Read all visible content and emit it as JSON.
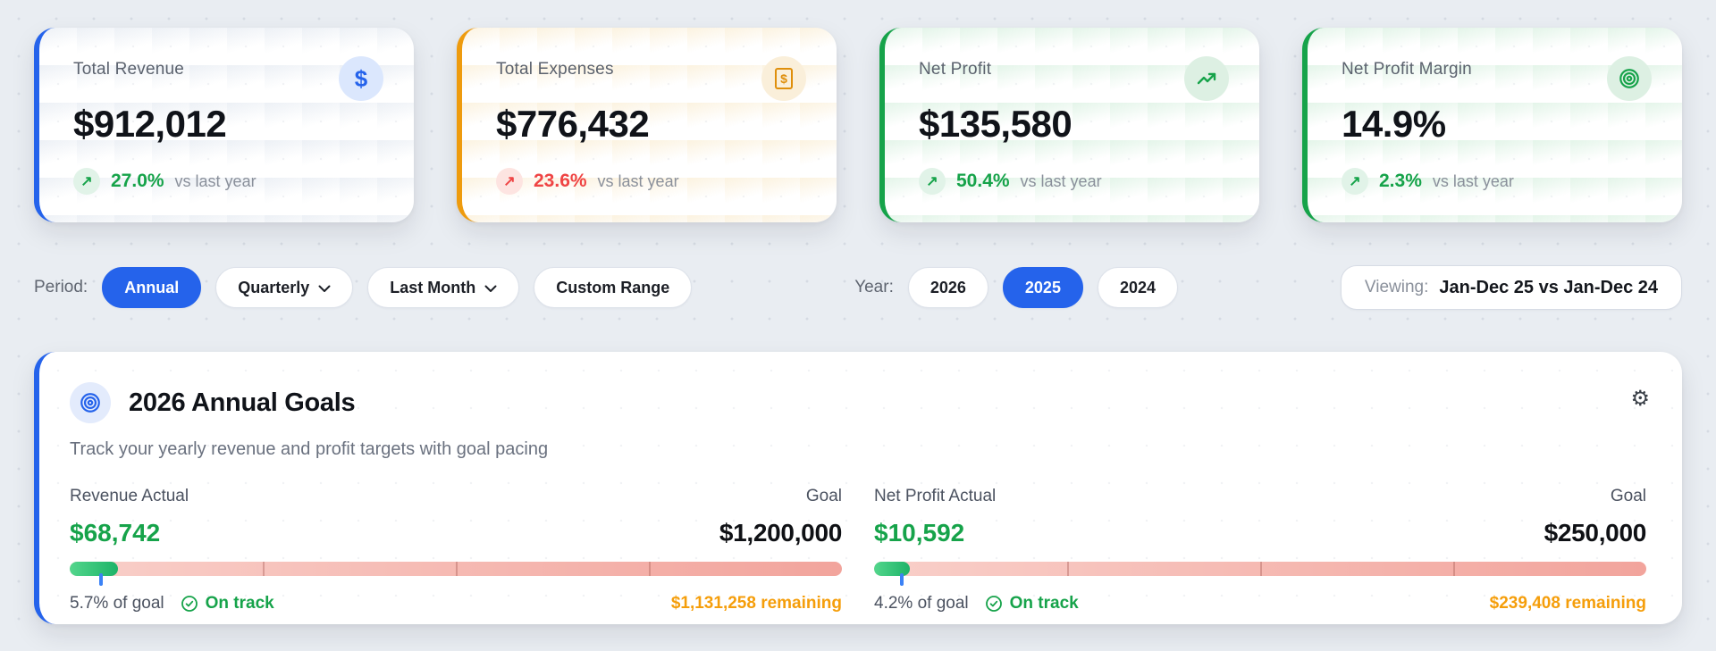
{
  "colors": {
    "accent_blue": "#2563eb",
    "accent_amber": "#ee9b0e",
    "accent_green": "#16a34a",
    "trend_up_green": "#16a34a",
    "trend_down_red": "#ef4444",
    "remaining_orange": "#f59e0b",
    "progress_fill_green": "#1db368",
    "progress_track_pink": "#f2a49c",
    "pace_marker_blue": "#3b82f6"
  },
  "labels": {
    "vs_last_year": "vs last year",
    "up_arrow": "↗"
  },
  "kpis": [
    {
      "label": "Total Revenue",
      "value": "$912,012",
      "trend_pct": "27.0%",
      "direction": "up",
      "icon": "dollar-icon",
      "accent": "#2563eb"
    },
    {
      "label": "Total Expenses",
      "value": "$776,432",
      "trend_pct": "23.6%",
      "direction": "down",
      "icon": "receipt-icon",
      "accent": "#ee9b0e"
    },
    {
      "label": "Net Profit",
      "value": "$135,580",
      "trend_pct": "50.4%",
      "direction": "up",
      "icon": "trending-up-icon",
      "accent": "#16a34a"
    },
    {
      "label": "Net Profit Margin",
      "value": "14.9%",
      "trend_pct": "2.3%",
      "direction": "up",
      "icon": "target-icon",
      "accent": "#16a34a"
    }
  ],
  "filters": {
    "period_label": "Period:",
    "period_options": [
      {
        "label": "Annual",
        "selected": true,
        "has_dropdown": false
      },
      {
        "label": "Quarterly",
        "selected": false,
        "has_dropdown": true
      },
      {
        "label": "Last Month",
        "selected": false,
        "has_dropdown": true
      },
      {
        "label": "Custom Range",
        "selected": false,
        "has_dropdown": false
      }
    ],
    "year_label": "Year:",
    "year_options": [
      {
        "label": "2026",
        "selected": false
      },
      {
        "label": "2025",
        "selected": true
      },
      {
        "label": "2024",
        "selected": false
      }
    ],
    "viewing_label": "Viewing:",
    "viewing_value": "Jan-Dec 25 vs Jan-Dec 24"
  },
  "goals": {
    "title": "2026 Annual Goals",
    "subtitle": "Track your yearly revenue and profit targets with goal pacing",
    "items": [
      {
        "actual_label": "Revenue Actual",
        "goal_label": "Goal",
        "actual": "$68,742",
        "goal": "$1,200,000",
        "progress_percent": 6.2,
        "pace_percent": 4.0,
        "percent_text": "5.7% of goal",
        "status": "On track",
        "remaining": "$1,131,258 remaining"
      },
      {
        "actual_label": "Net Profit Actual",
        "goal_label": "Goal",
        "actual": "$10,592",
        "goal": "$250,000",
        "progress_percent": 4.6,
        "pace_percent": 3.6,
        "percent_text": "4.2% of goal",
        "status": "On track",
        "remaining": "$239,408 remaining"
      }
    ]
  }
}
